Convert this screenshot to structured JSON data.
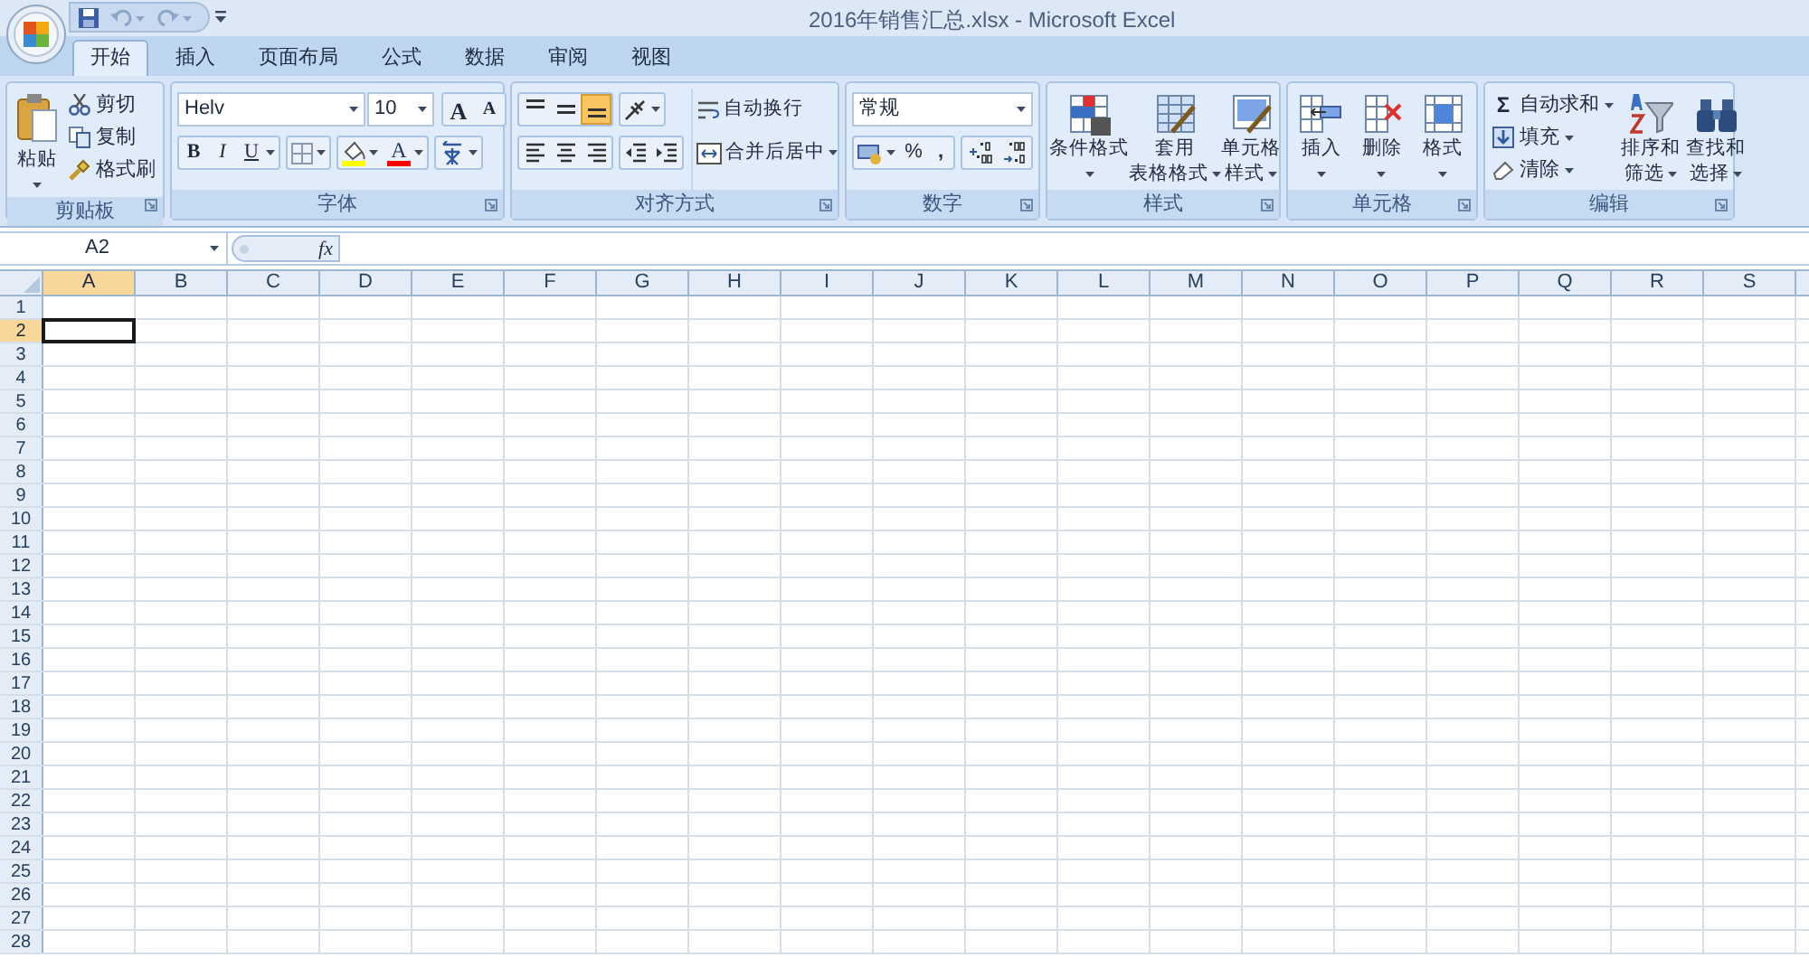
{
  "window": {
    "title": "2016年销售汇总.xlsx - Microsoft Excel"
  },
  "tabs": [
    {
      "label": "开始",
      "selected": true
    },
    {
      "label": "插入",
      "selected": false
    },
    {
      "label": "页面布局",
      "selected": false
    },
    {
      "label": "公式",
      "selected": false
    },
    {
      "label": "数据",
      "selected": false
    },
    {
      "label": "审阅",
      "selected": false
    },
    {
      "label": "视图",
      "selected": false
    }
  ],
  "clipboard": {
    "label": "剪贴板",
    "paste": "粘贴",
    "small_buttons": [
      "剪切",
      "复制",
      "格式刷"
    ]
  },
  "font": {
    "label": "字体",
    "font_name": "Helv",
    "font_size": "10",
    "size_buttons": [
      "A",
      "A"
    ],
    "style_buttons": [
      "B",
      "I",
      "U"
    ],
    "font_color": "A"
  },
  "alignment": {
    "label": "对齐方式",
    "vertical_align": [
      {
        "selected": false
      },
      {
        "selected": false
      },
      {
        "selected": true
      }
    ],
    "wrap_text": "自动换行",
    "merge": "合并后居中"
  },
  "number": {
    "label": "数字",
    "format": "常规",
    "percent": "%",
    "comma": ","
  },
  "styles": {
    "label": "样式",
    "buttons": [
      {
        "lines": [
          "条件格式"
        ]
      },
      {
        "lines": [
          "套用",
          "表格格式"
        ]
      },
      {
        "lines": [
          "单元格",
          "样式"
        ]
      }
    ]
  },
  "cells": {
    "label": "单元格",
    "buttons": [
      "插入",
      "删除",
      "格式"
    ]
  },
  "editing": {
    "label": "编辑",
    "sum_symbol": "Σ",
    "small_buttons": [
      "自动求和",
      "填充",
      "清除"
    ],
    "big_buttons": [
      {
        "lines": [
          "排序和",
          "筛选"
        ]
      },
      {
        "lines": [
          "查找和",
          "选择"
        ]
      }
    ]
  },
  "formula_bar": {
    "name_box": "A2",
    "fx": "fx"
  },
  "grid": {
    "columns": [
      {
        "label": "A",
        "selected": true
      },
      {
        "label": "B",
        "selected": false
      },
      {
        "label": "C",
        "selected": false
      },
      {
        "label": "D",
        "selected": false
      },
      {
        "label": "E",
        "selected": false
      },
      {
        "label": "F",
        "selected": false
      },
      {
        "label": "G",
        "selected": false
      },
      {
        "label": "H",
        "selected": false
      },
      {
        "label": "I",
        "selected": false
      },
      {
        "label": "J",
        "selected": false
      },
      {
        "label": "K",
        "selected": false
      },
      {
        "label": "L",
        "selected": false
      },
      {
        "label": "M",
        "selected": false
      },
      {
        "label": "N",
        "selected": false
      },
      {
        "label": "O",
        "selected": false
      },
      {
        "label": "P",
        "selected": false
      },
      {
        "label": "Q",
        "selected": false
      },
      {
        "label": "R",
        "selected": false
      },
      {
        "label": "S",
        "selected": false
      }
    ],
    "rows": [
      {
        "label": "1",
        "selected": false
      },
      {
        "label": "2",
        "selected": true
      },
      {
        "label": "3",
        "selected": false
      },
      {
        "label": "4",
        "selected": false
      },
      {
        "label": "5",
        "selected": false
      },
      {
        "label": "6",
        "selected": false
      },
      {
        "label": "7",
        "selected": false
      },
      {
        "label": "8",
        "selected": false
      },
      {
        "label": "9",
        "selected": false
      },
      {
        "label": "10",
        "selected": false
      },
      {
        "label": "11",
        "selected": false
      },
      {
        "label": "12",
        "selected": false
      },
      {
        "label": "13",
        "selected": false
      },
      {
        "label": "14",
        "selected": false
      },
      {
        "label": "15",
        "selected": false
      },
      {
        "label": "16",
        "selected": false
      },
      {
        "label": "17",
        "selected": false
      },
      {
        "label": "18",
        "selected": false
      },
      {
        "label": "19",
        "selected": false
      },
      {
        "label": "20",
        "selected": false
      },
      {
        "label": "21",
        "selected": false
      },
      {
        "label": "22",
        "selected": false
      },
      {
        "label": "23",
        "selected": false
      },
      {
        "label": "24",
        "selected": false
      },
      {
        "label": "25",
        "selected": false
      },
      {
        "label": "26",
        "selected": false
      },
      {
        "label": "27",
        "selected": false
      },
      {
        "label": "28",
        "selected": false
      }
    ]
  }
}
